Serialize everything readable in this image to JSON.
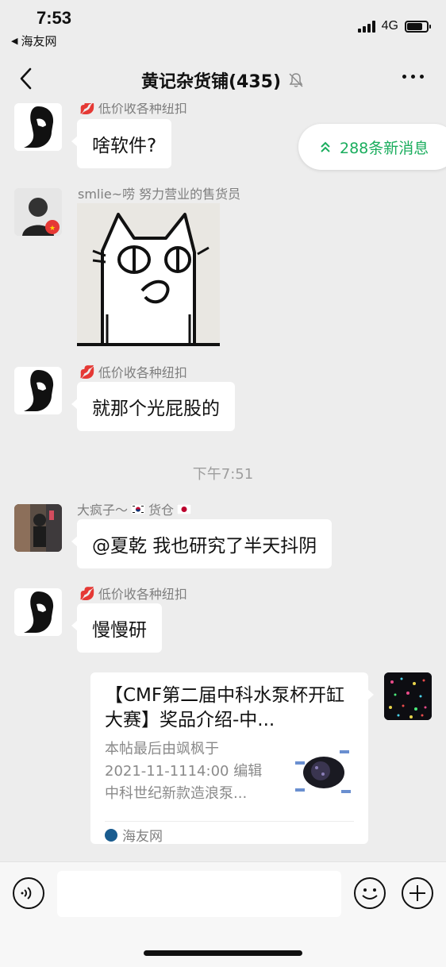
{
  "status": {
    "time": "7:53",
    "back_app": "海友网",
    "network": "4G"
  },
  "header": {
    "title": "黄记杂货铺(435)"
  },
  "new_messages": {
    "label": "288条新消息"
  },
  "messages": [
    {
      "sender": "低价收各种纽扣",
      "text": "啥软件?"
    },
    {
      "sender": "smlie~唠 努力营业的售货员",
      "type": "sticker"
    },
    {
      "sender": "低价收各种纽扣",
      "text": "就那个光屁股的"
    },
    {
      "time_separator": "下午7:51"
    },
    {
      "sender": "大疯子～",
      "sender_tail": "货仓",
      "text": "@夏乾 我也研究了半天抖阴"
    },
    {
      "sender": "低价收各种纽扣",
      "text": "慢慢研"
    },
    {
      "type": "link_card",
      "title": "【CMF第二届中科水泵杯开缸大赛】奖品介绍-中...",
      "desc_lines": [
        "本帖最后由飒枫于",
        "2021-11-1114:00 编辑",
        "中科世纪新款造浪泵..."
      ],
      "source": "海友网"
    }
  ],
  "input": {
    "placeholder": ""
  },
  "colors": {
    "background": "#ededed",
    "bubble": "#ffffff",
    "accent_green": "#1aad5d"
  }
}
